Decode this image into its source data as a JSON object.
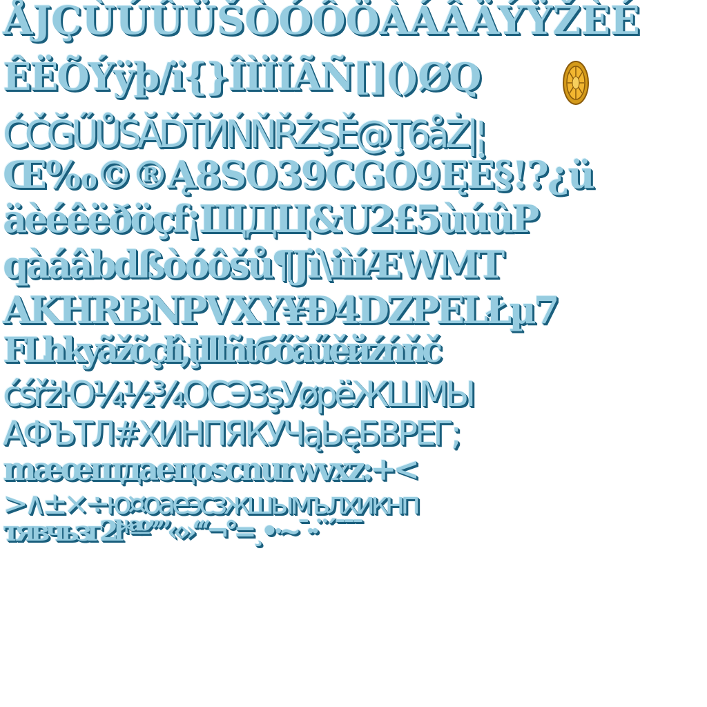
{
  "rows": [
    "ÅJÇÙÚÛÜŠÒÓÔÖÀÁÂÄÝŸŽÈÉ",
    "ÊËÕÝÿþ/ï{}ÎÌÏÍÃÑ[]()ØQ",
    "ĆČĞŰŮŚĂĎŤЙŃŇŘŹŞĚ@Ţ6åŻ|¦",
    "Œ‰©®Ą8SO39CGO9ĘĖ§!?¿ü",
    "äèéêëðöçf¡ЩДЦ&U2£5ùúûP",
    "qàáâbdßòóôšů¶Jï\\iìíÆWMT",
    "AKHRBNPVXY¥Đ4DZPELŁµ7",
    "FLhkyãžõçłî,ţlllñtбőăűěйźńňč",
    "ćśřżЮ¼½¾OCЭЗşУøpëЖШМЫ",
    "АФЪТЛ#ХИНПЯКУЧąЬęБВРЕГ;",
    "mæœщдaeцoscnurwvxz:+<",
    ">∧±×÷ю¤oaeэcзжшымълхикнп",
    "тявчьзг2l*ªº’’”«»‘‘‘¬°=¸•·~¯··¨´¯¯¯"
  ],
  "icons": {
    "coin": "gold-coin-icon"
  },
  "colors": {
    "glyph_fill": "#96cce0",
    "glyph_shadow": "#1a5f7d",
    "glyph_highlight": "#e6f6fc",
    "coin_outer": "#d49a1a",
    "coin_inner": "#f2b630",
    "coin_line": "#8a5b0c",
    "background": "#ffffff"
  }
}
